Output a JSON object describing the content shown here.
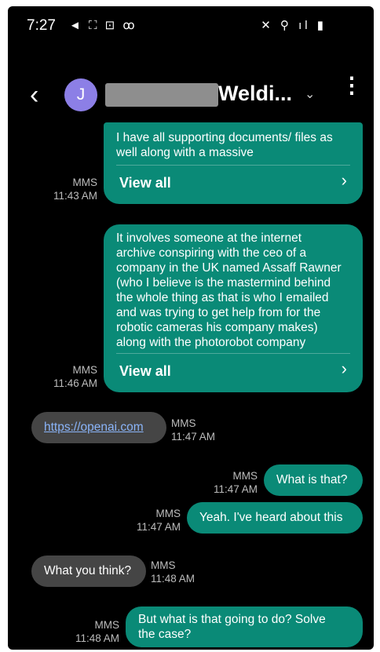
{
  "status_bar": {
    "time": "7:27",
    "left_icons": "◄ ⛶ ⊡ ꝏ",
    "right_icons": "✕ ⚲ ıl ▮"
  },
  "header": {
    "avatar_letter": "J",
    "contact_name": "Weldi...",
    "back_icon": "‹",
    "dropdown_icon": "⌄",
    "more_icon": "⋮"
  },
  "messages": [
    {
      "direction": "out",
      "lines": [
        "I have all supporting documents/ files as",
        "well along with a massive"
      ],
      "action": "View all",
      "meta_type": "MMS",
      "meta_time": "11:43 AM"
    },
    {
      "direction": "out",
      "lines": [
        "It involves someone at the internet",
        "archive conspiring with the ceo of a",
        "company in the UK named Assaff Rawner",
        "(who I believe is the mastermind behind",
        "the whole thing as that is who I emailed",
        "and was trying to get help from for the",
        "robotic cameras his company makes)",
        "along with the photorobot company"
      ],
      "action": "View all",
      "meta_type": "MMS",
      "meta_time": "11:46 AM"
    },
    {
      "direction": "in",
      "link": "https://openai.com",
      "meta_type": "MMS",
      "meta_time": "11:47 AM"
    },
    {
      "direction": "out",
      "text": "What is that?",
      "meta_type": "MMS",
      "meta_time": "11:47 AM"
    },
    {
      "direction": "out",
      "text": "Yeah.  I've heard about this",
      "meta_type": "MMS",
      "meta_time": "11:47 AM"
    },
    {
      "direction": "in",
      "text": "What you think?",
      "meta_type": "MMS",
      "meta_time": "11:48 AM"
    },
    {
      "direction": "out",
      "lines": [
        "But what is that going to do? Solve",
        "the case?"
      ],
      "meta_type": "MMS",
      "meta_time": "11:48 AM"
    }
  ],
  "colors": {
    "outgoing_bubble": "#0a8a77",
    "incoming_bubble": "#454545",
    "avatar": "#8c7fe6",
    "background": "#000000"
  }
}
